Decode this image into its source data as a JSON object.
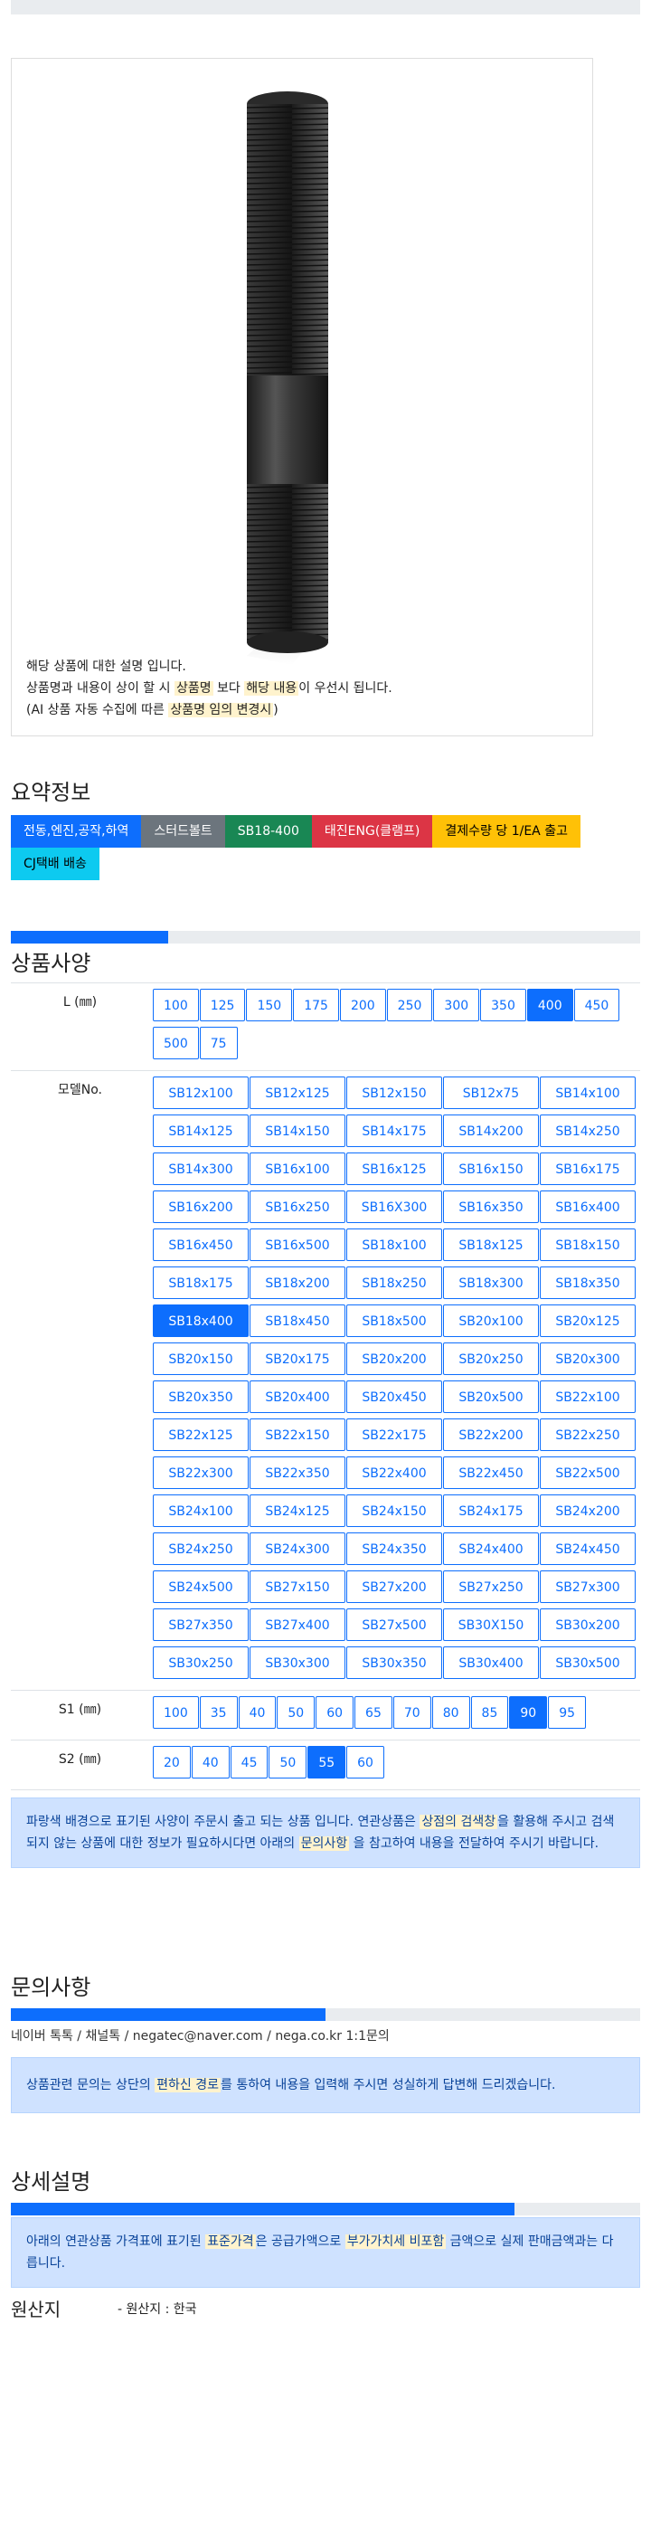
{
  "product_image": {
    "desc_lines": [
      "해당 상품에 대한 설명 입니다."
    ],
    "line2": {
      "a": "상품명과 내용이 상이 할 시 ",
      "b": "상품명",
      "c": " 보다 ",
      "d": "해당 내용",
      "e": "이 우선시 됩니다."
    },
    "line3": {
      "a": "(AI 상품 자동 수집에 따른 ",
      "b": "상품명 임의 변경시",
      "c": ")"
    }
  },
  "summary": {
    "title": "요약정보",
    "badges": [
      {
        "label": "전동,엔진,공작,하역",
        "color": "#0d6efd"
      },
      {
        "label": "스터드볼트",
        "color": "#6c757d"
      },
      {
        "label": "SB18-400",
        "color": "#198754"
      },
      {
        "label": "태진ENG(클램프)",
        "color": "#dc3545"
      },
      {
        "label": "결제수량 당 1/EA 출고",
        "color": "#ffc107"
      },
      {
        "label": "CJ택배 배송",
        "color": "#0dcaf0"
      }
    ]
  },
  "spec": {
    "title": "상품사양",
    "progress": 0.25,
    "rows": [
      {
        "label": "L (㎜)",
        "options": [
          "100",
          "125",
          "150",
          "175",
          "200",
          "250",
          "300",
          "350",
          "400",
          "450",
          "500",
          "75"
        ],
        "selected": "400"
      },
      {
        "label": "모델No.",
        "options": [
          "SB12x100",
          "SB12x125",
          "SB12x150",
          "SB12x75",
          "SB14x100",
          "SB14x125",
          "SB14x150",
          "SB14x175",
          "SB14x200",
          "SB14x250",
          "SB14x300",
          "SB16x100",
          "SB16x125",
          "SB16x150",
          "SB16x175",
          "SB16x200",
          "SB16x250",
          "SB16X300",
          "SB16x350",
          "SB16x400",
          "SB16x450",
          "SB16x500",
          "SB18x100",
          "SB18x125",
          "SB18x150",
          "SB18x175",
          "SB18x200",
          "SB18x250",
          "SB18x300",
          "SB18x350",
          "SB18x400",
          "SB18x450",
          "SB18x500",
          "SB20x100",
          "SB20x125",
          "SB20x150",
          "SB20x175",
          "SB20x200",
          "SB20x250",
          "SB20x300",
          "SB20x350",
          "SB20x400",
          "SB20x450",
          "SB20x500",
          "SB22x100",
          "SB22x125",
          "SB22x150",
          "SB22x175",
          "SB22x200",
          "SB22x250",
          "SB22x300",
          "SB22x350",
          "SB22x400",
          "SB22x450",
          "SB22x500",
          "SB24x100",
          "SB24x125",
          "SB24x150",
          "SB24x175",
          "SB24x200",
          "SB24x250",
          "SB24x300",
          "SB24x350",
          "SB24x400",
          "SB24x450",
          "SB24x500",
          "SB27x150",
          "SB27x200",
          "SB27x250",
          "SB27x300",
          "SB27x350",
          "SB27x400",
          "SB27x500",
          "SB30X150",
          "SB30x200",
          "SB30x250",
          "SB30x300",
          "SB30x350",
          "SB30x400",
          "SB30x500"
        ],
        "selected": "SB18x400"
      },
      {
        "label": "S1 (㎜)",
        "options": [
          "100",
          "35",
          "40",
          "50",
          "60",
          "65",
          "70",
          "80",
          "85",
          "90",
          "95"
        ],
        "selected": "90"
      },
      {
        "label": "S2 (㎜)",
        "options": [
          "20",
          "40",
          "45",
          "50",
          "55",
          "60"
        ],
        "selected": "55"
      }
    ],
    "notice": {
      "a": "파랑색 배경으로 표기된 사양이 주문시 출고 되는 상품 입니다. 연관상품은 ",
      "b": "상점의 검색창",
      "c": "을 활용해 주시고 검색되지 않는 상품에 대한 정보가 필요하시다면 아래의 ",
      "d": "문의사항",
      "e": " 을 참고하여 내용을 전달하여 주시기 바랍니다."
    }
  },
  "inquiry": {
    "title": "문의사항",
    "progress": 0.5,
    "links": [
      "네이버 톡톡",
      "채널톡",
      "negatec@naver.com",
      "nega.co.kr 1:1문의"
    ],
    "notice": {
      "a": "상품관련 문의는 상단의 ",
      "b": "편하신 경로",
      "c": "를 통하여 내용을 입력해 주시면 성실하게 답변해 드리겠습니다."
    }
  },
  "detail": {
    "title": "상세설명",
    "progress": 0.8,
    "notice": {
      "a": "아래의 연관상품 가격표에 표기된 ",
      "b": "표준가격",
      "c": "은 공급가액으로 ",
      "d": "부가가치세 비포함",
      "e": " 금액으로 실제 판매금액과는 다릅니다."
    }
  },
  "origin": {
    "title": "원산지",
    "value": "- 원산지 : 한국"
  }
}
